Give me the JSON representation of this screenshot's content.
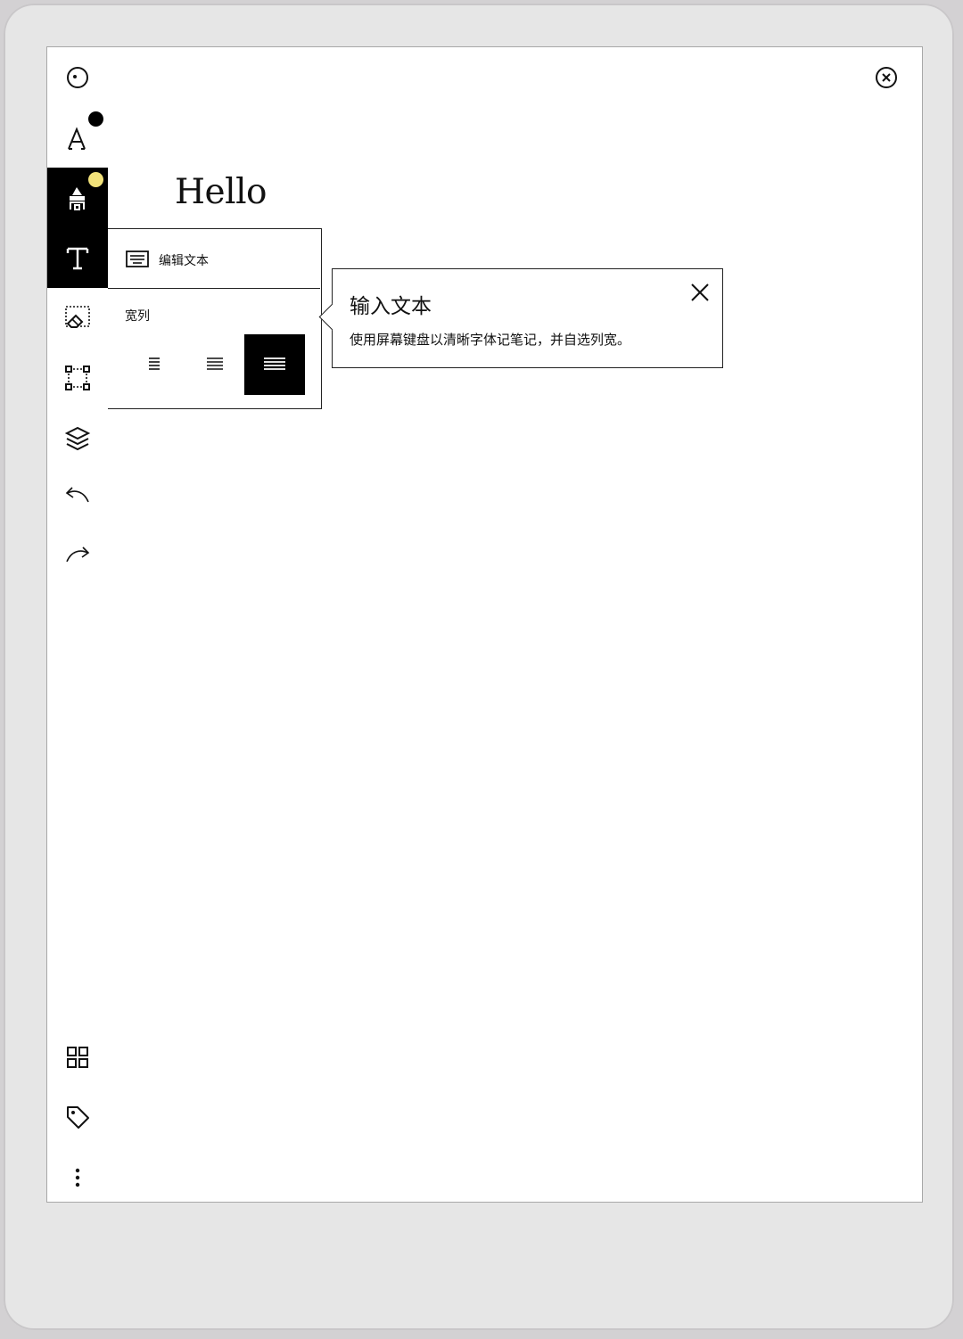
{
  "document": {
    "text": "Hello"
  },
  "sidebar": {
    "active_tool": "text",
    "icons": [
      "home-icon",
      "pen-tool-icon",
      "highlighter-icon",
      "text-tool-icon",
      "eraser-selection-icon",
      "selection-icon",
      "layers-icon",
      "undo-icon",
      "redo-icon",
      "pages-grid-icon",
      "tag-icon",
      "more-icon"
    ],
    "pen_indicator_color": "#000000",
    "highlighter_indicator_color": "#f2e27a"
  },
  "text_menu": {
    "edit_text_label": "编辑文本",
    "column_width_label": "宽列",
    "width_options": [
      "narrow",
      "medium",
      "wide"
    ],
    "selected_width": "wide"
  },
  "popover": {
    "title": "输入文本",
    "body": "使用屏幕键盘以清晰字体记笔记，并自选列宽。"
  },
  "header": {
    "close_icon": "close-circle-icon"
  }
}
